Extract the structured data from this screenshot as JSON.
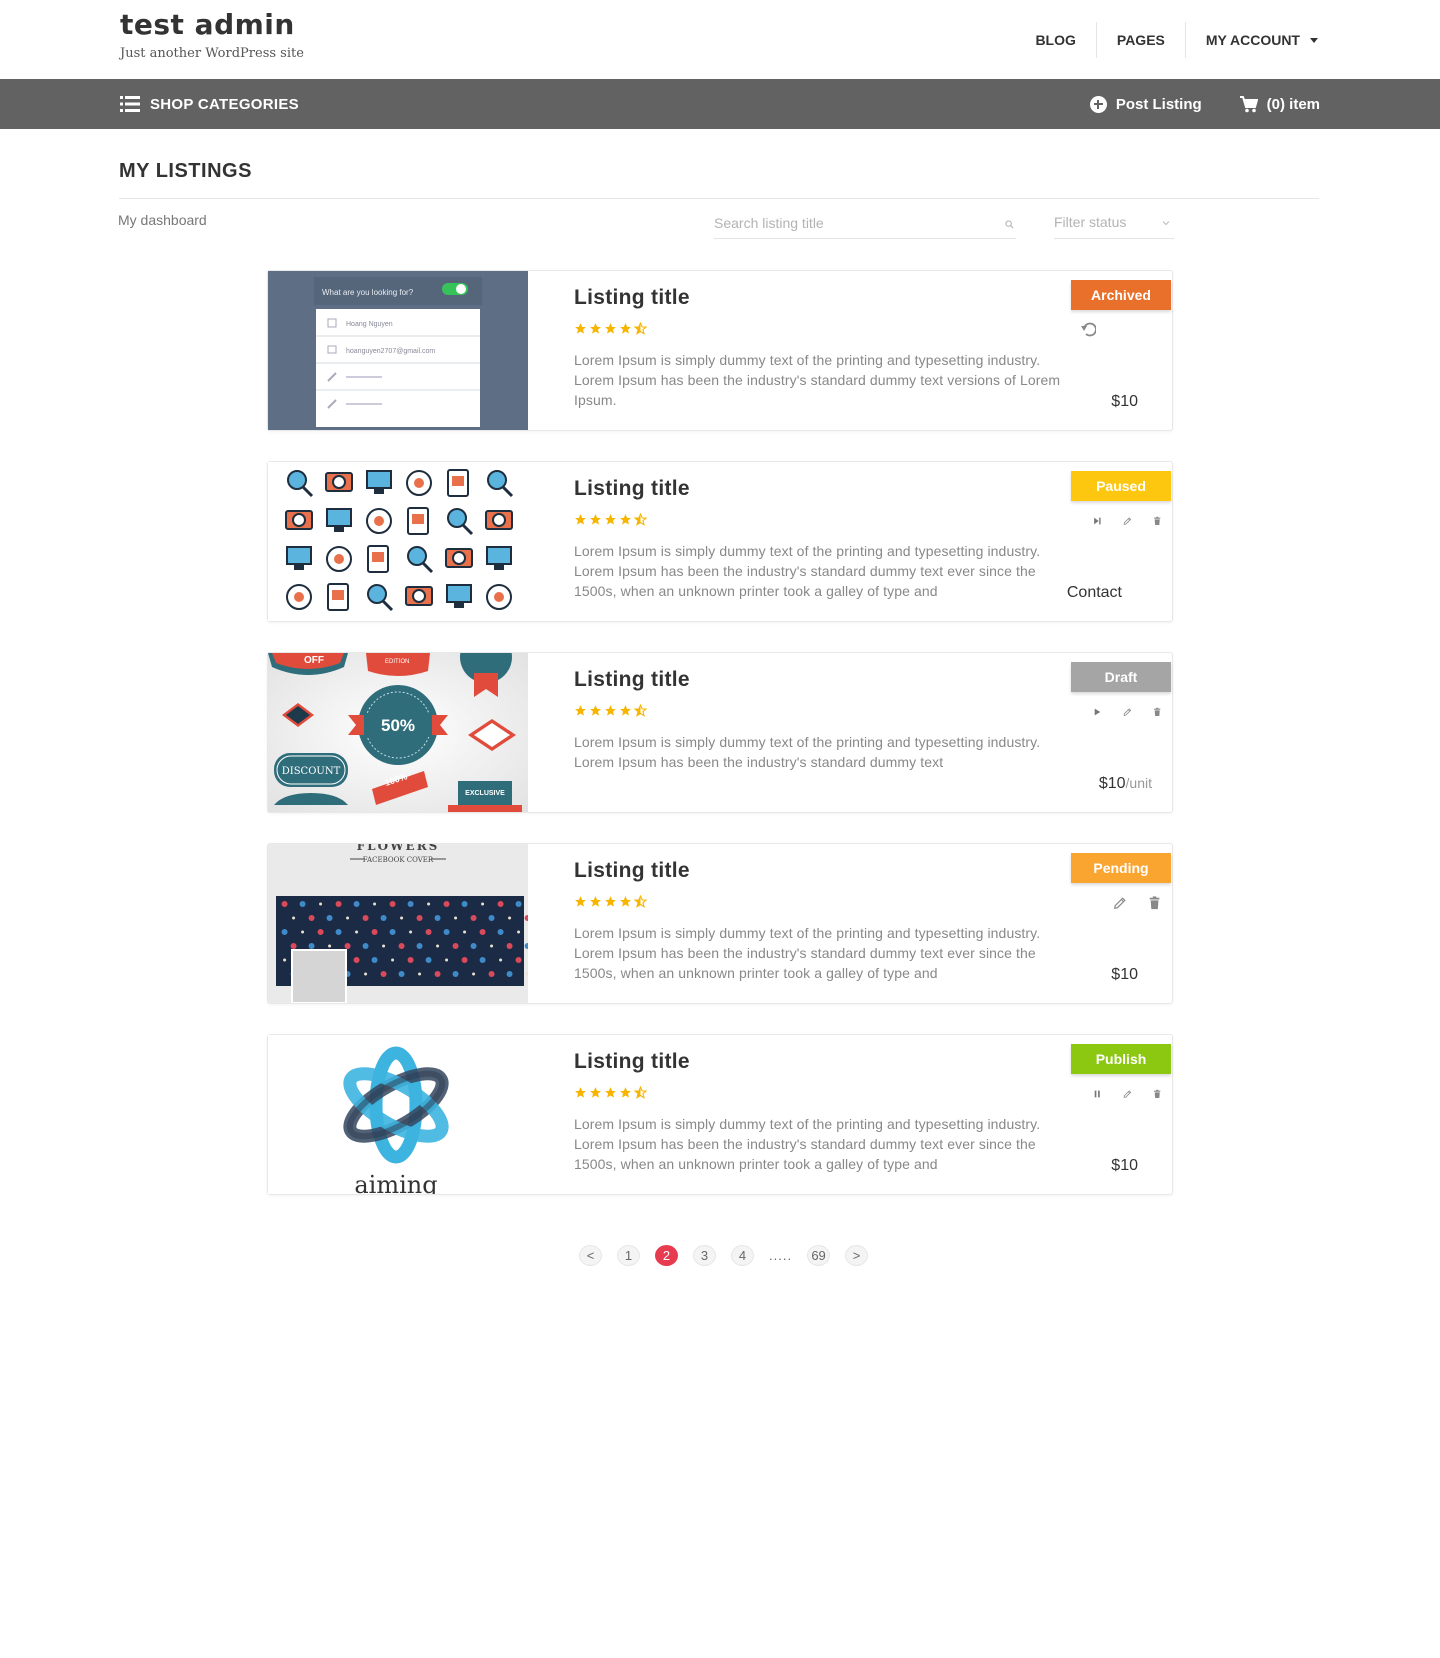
{
  "header": {
    "site_title": "test admin",
    "tagline": "Just another WordPress site",
    "nav": [
      "BLOG",
      "PAGES",
      "MY ACCOUNT"
    ]
  },
  "bar": {
    "shop_categories": "SHOP CATEGORIES",
    "post_listing": "Post Listing",
    "cart": "(0) item",
    "bg_color": "#626262"
  },
  "page": {
    "title": "MY LISTINGS",
    "breadcrumb": "My dashboard",
    "search_placeholder": "Search listing title",
    "filter_placeholder": "Filter status"
  },
  "listings": [
    {
      "title": "Listing title",
      "rating": 4.5,
      "description": "Lorem Ipsum is simply dummy text of the printing and typesetting industry. Lorem Ipsum has been the industry's standard dummy text versions of Lorem Ipsum.",
      "status": "Archived",
      "status_color": "#e8702a",
      "actions": [
        "restore-icon"
      ],
      "price": "$10",
      "unit": "",
      "thumb": "form",
      "thumb_text": [
        "What are you looking for?",
        "Hoang Nguyen",
        "hoanguyen2707@gmail.com"
      ]
    },
    {
      "title": "Listing title",
      "rating": 4.5,
      "description": "Lorem Ipsum is simply dummy text of the printing and typesetting industry. Lorem Ipsum has been the industry's standard dummy text ever since the 1500s, when an unknown printer took a galley of type and",
      "status": "Paused",
      "status_color": "#fdc70f",
      "actions": [
        "resume-icon",
        "edit-icon",
        "delete-icon"
      ],
      "price": "Contact",
      "unit": "",
      "thumb": "icons",
      "thumb_text": []
    },
    {
      "title": "Listing title",
      "rating": 4.5,
      "description": "Lorem Ipsum is simply dummy text of the printing and typesetting industry. Lorem Ipsum has been the industry's standard dummy text",
      "status": "Draft",
      "status_color": "#a5a5a5",
      "actions": [
        "play-icon",
        "edit-icon",
        "delete-icon"
      ],
      "price": "$10",
      "unit": "/unit",
      "thumb": "badges",
      "thumb_text": [
        "OFF",
        "EDITION",
        "50%",
        "DISCOUNT",
        "100%",
        "EXCLUSIVE"
      ]
    },
    {
      "title": "Listing title",
      "rating": 4.5,
      "description": "Lorem Ipsum is simply dummy text of the printing and typesetting industry. Lorem Ipsum has been the industry's standard dummy text ever since the 1500s, when an unknown printer took a galley of type and",
      "status": "Pending",
      "status_color": "#fba531",
      "actions": [
        "edit-icon",
        "delete-icon"
      ],
      "price": "$10",
      "unit": "",
      "thumb": "flowers",
      "thumb_text": [
        "FLOWERS",
        "FACEBOOK COVER"
      ]
    },
    {
      "title": "Listing title",
      "rating": 4.5,
      "description": "Lorem Ipsum is simply dummy text of the printing and typesetting industry. Lorem Ipsum has been the industry's standard dummy text ever since the 1500s, when an unknown printer took a galley of type and",
      "status": "Publish",
      "status_color": "#8cc811",
      "actions": [
        "pause-icon",
        "edit-icon",
        "delete-icon"
      ],
      "price": "$10",
      "unit": "",
      "thumb": "logo",
      "thumb_text": [
        "aiming"
      ]
    }
  ],
  "pagination": {
    "prev": "<",
    "pages": [
      "1",
      "2",
      "3",
      "4"
    ],
    "active": "2",
    "dots": ".....",
    "last": "69",
    "next": ">"
  },
  "colors": {
    "star": "#f7b500",
    "page_active": "#e73b50"
  }
}
